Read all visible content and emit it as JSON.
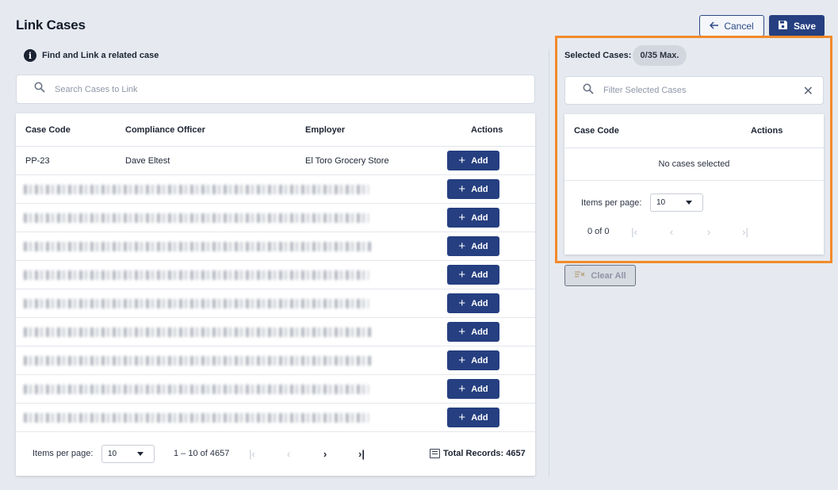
{
  "page": {
    "title": "Link Cases"
  },
  "header": {
    "cancel_label": "Cancel",
    "save_label": "Save"
  },
  "info": {
    "text": "Find and Link a related case"
  },
  "search": {
    "placeholder": "Search Cases to Link"
  },
  "cases_table": {
    "columns": [
      "Case Code",
      "Compliance Officer",
      "Employer",
      "Actions"
    ],
    "rows": [
      {
        "case_code": "PP-23",
        "officer": "Dave Eltest",
        "employer": "El Toro Grocery Store",
        "action": "Add",
        "redacted": false
      },
      {
        "action": "Add",
        "redacted": true
      },
      {
        "action": "Add",
        "redacted": true
      },
      {
        "action": "Add",
        "redacted": true
      },
      {
        "action": "Add",
        "redacted": true
      },
      {
        "action": "Add",
        "redacted": true
      },
      {
        "action": "Add",
        "redacted": true
      },
      {
        "action": "Add",
        "redacted": true
      },
      {
        "action": "Add",
        "redacted": true
      },
      {
        "action": "Add",
        "redacted": true
      }
    ]
  },
  "pager": {
    "items_per_page_label": "Items per page:",
    "items_per_page_value": "10",
    "range": "1 – 10 of 4657",
    "total_records": "Total Records: 4657"
  },
  "selected": {
    "label": "Selected Cases:",
    "badge": "0/35 Max.",
    "filter_placeholder": "Filter Selected Cases",
    "columns": [
      "Case Code",
      "Actions"
    ],
    "empty_text": "No cases selected",
    "items_per_page_label": "Items per page:",
    "items_per_page_value": "10",
    "range": "0 of 0",
    "clear_all_label": "Clear All"
  },
  "colors": {
    "primary": "#253f80",
    "highlight": "#f28a2a",
    "background": "#e6eaf0"
  },
  "icons": [
    "arrow-left-icon",
    "save-icon",
    "info-icon",
    "search-icon",
    "plus-icon",
    "chevron-down-icon",
    "first-page-icon",
    "prev-page-icon",
    "next-page-icon",
    "last-page-icon",
    "list-icon",
    "close-icon",
    "clear-icon"
  ]
}
